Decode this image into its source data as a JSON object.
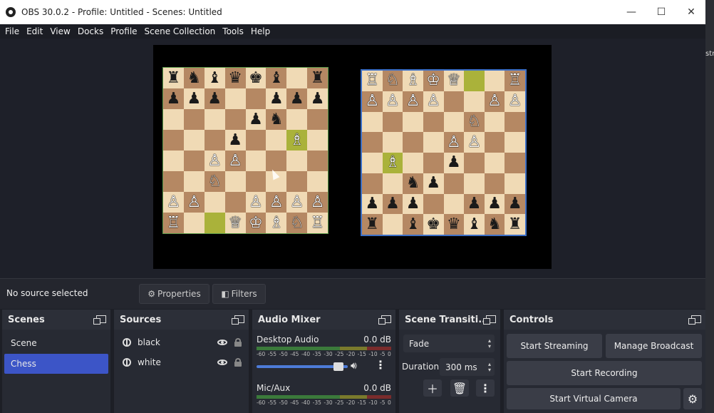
{
  "window": {
    "title": "OBS 30.0.2 - Profile: Untitled - Scenes: Untitled",
    "minimize": "—",
    "maximize": "☐",
    "close": "✕"
  },
  "menu": [
    "File",
    "Edit",
    "View",
    "Docks",
    "Profile",
    "Scene Collection",
    "Tools",
    "Help"
  ],
  "edge_text": "str",
  "boards": {
    "left": [
      [
        "♜",
        "♞",
        "♝",
        "♛",
        "♛",
        "♚",
        "♝",
        "",
        "♜"
      ],
      [
        "♟",
        "♟",
        "♟",
        "",
        "",
        "♟",
        "♟",
        "♟"
      ],
      [
        "",
        "",
        "",
        "",
        "♟",
        "♞",
        "",
        ""
      ],
      [
        "",
        "",
        "",
        "♟",
        "",
        "",
        "♗",
        ""
      ],
      [
        "",
        "",
        "♙",
        "♙",
        "",
        "",
        "",
        ""
      ],
      [
        "",
        "",
        "♘",
        "",
        "",
        "",
        "",
        ""
      ],
      [
        "♙",
        "♙",
        "",
        "",
        "♙",
        "♙",
        "♙",
        "♙"
      ],
      [
        "♖",
        "",
        "",
        "♕",
        "♔",
        "♗",
        "♘",
        "♖"
      ]
    ],
    "right": [
      [
        "♖",
        "♘",
        "♗",
        "♔",
        "♕",
        "",
        "",
        "♖"
      ],
      [
        "♙",
        "♙",
        "♙",
        "♙",
        "",
        "",
        "♙",
        "♙"
      ],
      [
        "",
        "",
        "",
        "",
        "",
        "♘",
        "",
        ""
      ],
      [
        "",
        "",
        "",
        "",
        "♙",
        "♙",
        "",
        ""
      ],
      [
        "",
        "♗",
        "",
        "",
        "♟",
        "",
        "",
        ""
      ],
      [
        "",
        "",
        "♞",
        "♟",
        "",
        "",
        "",
        ""
      ],
      [
        "♟",
        "♟",
        "♟",
        "",
        "",
        "♟",
        "♟",
        "♟"
      ],
      [
        "♜",
        "",
        "♝",
        "♚",
        "♛",
        "♝",
        "♞",
        "♜"
      ]
    ]
  },
  "source_bar": {
    "status": "No source selected",
    "properties": "Properties",
    "filters": "Filters"
  },
  "scenes": {
    "title": "Scenes",
    "items": [
      "Scene",
      "Chess"
    ],
    "selected": "Chess"
  },
  "sources": {
    "title": "Sources",
    "items": [
      "black",
      "white"
    ]
  },
  "mixer": {
    "title": "Audio Mixer",
    "channels": [
      {
        "name": "Desktop Audio",
        "level": "0.0 dB"
      },
      {
        "name": "Mic/Aux",
        "level": "0.0 dB"
      }
    ],
    "ticks": [
      "-60",
      "-55",
      "-50",
      "-45",
      "-40",
      "-35",
      "-30",
      "-25",
      "-20",
      "-15",
      "-10",
      "-5",
      "0"
    ],
    "volume_fraction": 0.95
  },
  "transitions": {
    "title": "Scene Transiti...",
    "type": "Fade",
    "duration_label": "Duration",
    "duration": "300 ms"
  },
  "controls": {
    "title": "Controls",
    "start_streaming": "Start Streaming",
    "manage_broadcast": "Manage Broadcast",
    "start_recording": "Start Recording",
    "start_virtual_camera": "Start Virtual Camera"
  },
  "colors": {
    "accent": "#3c55c7",
    "dock_bg": "#272a33",
    "light_square": "#f0dab5",
    "dark_square": "#b58863",
    "highlight": "#aab23a"
  }
}
